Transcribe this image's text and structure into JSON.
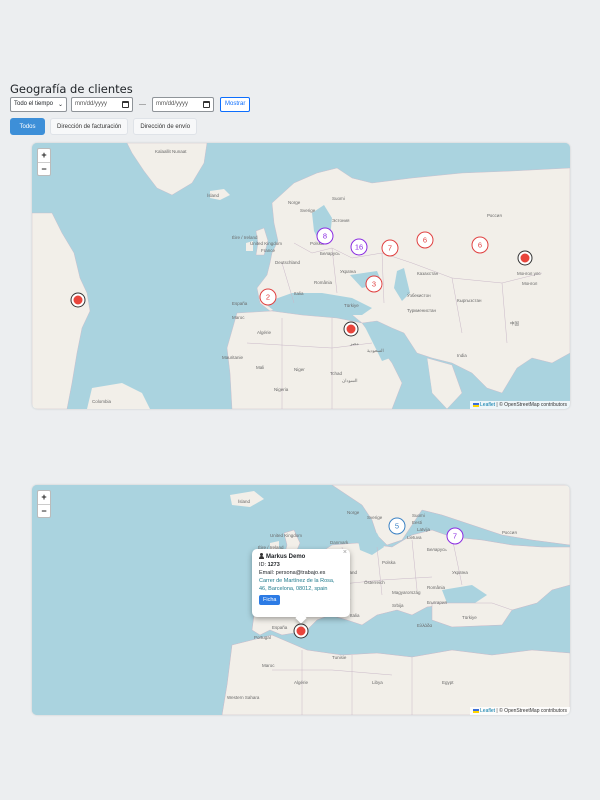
{
  "page": {
    "title": "Geografía de clientes"
  },
  "filters": {
    "period_select": "Todo el tiempo",
    "date_from_placeholder": "mm/dd/yyyy",
    "date_separator": "—",
    "date_to_placeholder": "mm/dd/yyyy",
    "show_button": "Mostrar"
  },
  "tabs": [
    {
      "label": "Todos",
      "active": true
    },
    {
      "label": "Dirección de facturación",
      "active": false
    },
    {
      "label": "Dirección de envío",
      "active": false
    }
  ],
  "map_controls": {
    "zoom_in": "+",
    "zoom_out": "−"
  },
  "attribution": {
    "leaflet": "Leaflet",
    "osm": "| © OpenStreetMap contributors"
  },
  "map1": {
    "clusters": [
      {
        "count": "8",
        "color": "purple"
      },
      {
        "count": "16",
        "color": "purple"
      },
      {
        "count": "7",
        "color": "red"
      },
      {
        "count": "6",
        "color": "red"
      },
      {
        "count": "6",
        "color": "red"
      },
      {
        "count": "2",
        "color": "red"
      },
      {
        "count": "3",
        "color": "red"
      }
    ],
    "labels": [
      "Kalaallit Nunaat",
      "Ísland",
      "Norge",
      "Suomi",
      "United Kingdom",
      "Deutschland",
      "France",
      "España",
      "Polska",
      "Беларусь",
      "Україна",
      "România",
      "Türkiye",
      "Россия",
      "Казахстан",
      "Монгол улс",
      "Algérie",
      "Mali",
      "Niger",
      "Nigeria",
      "Tchad",
      "مصر",
      "India",
      "中国",
      "Colombia",
      "Maroc",
      "Sverige",
      "Italia",
      "Éire / Ireland",
      "Туркменистан",
      "Ўзбекистон",
      "السعودية",
      "Mauritanie",
      "السودان",
      "Кыргызстан",
      "Монгол",
      "Эстония"
    ]
  },
  "map2": {
    "clusters": [
      {
        "count": "5",
        "color": "blue"
      },
      {
        "count": "7",
        "color": "purple"
      }
    ],
    "labels": [
      "Ísland",
      "Norge",
      "Sverige",
      "Suomi",
      "United Kingdom",
      "Éire / Ireland",
      "Deutschland",
      "Polska",
      "France",
      "España",
      "Portugal",
      "Italia",
      "Maroc",
      "Algérie",
      "Tunisie",
      "Libya",
      "Ελλάδα",
      "Türkiye",
      "Україна",
      "Беларусь",
      "Россия",
      "România",
      "Egypt",
      "Western Sahara",
      "Schweiz",
      "Österreich",
      "Magyarország",
      "Srbija",
      "България",
      "Danmark",
      "Lietuva",
      "Latvija",
      "Eesti"
    ]
  },
  "popup": {
    "close": "×",
    "name": "Markus Demo",
    "id_label": "ID: ",
    "id_value": "1273",
    "email": "Email: persona@trabajo.es",
    "address": "Carrer de Martínez de la Rosa, 46, Barcelona, 08012, spain",
    "button": "Ficha"
  },
  "colors": {
    "water": "#aad3df",
    "land": "#f2efe9",
    "accent": "#3d8fd8",
    "marker": "#e8453c"
  }
}
